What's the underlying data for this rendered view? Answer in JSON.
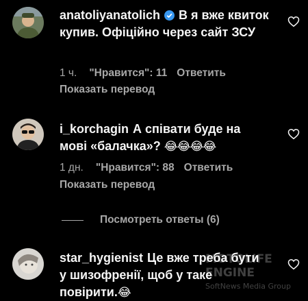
{
  "comments": [
    {
      "username": "anatoliyanatolich",
      "verified": true,
      "text": "В я вже квиток купив. Офіційно через сайт ЗСУ",
      "time": "1 ч.",
      "likes": "\"Нравится\": 11",
      "reply": "Ответить",
      "translate": "Показать перевод",
      "avatar_icon": "avatar-man-icon"
    },
    {
      "username": "i_korchagin",
      "verified": false,
      "text_line1": "А співати буде на",
      "text_line2": "мові «балачка»?",
      "emoji": "😂😂😂😂",
      "time": "1 дн.",
      "likes": "\"Нравится\": 88",
      "reply": "Ответить",
      "translate": "Показать перевод",
      "replies_label": "Посмотреть ответы (6)",
      "avatar_icon": "avatar-sunglasses-icon"
    },
    {
      "username": "star_hygienist",
      "verified": false,
      "text_line1": "Це вже треба бути",
      "text_line2": "у шизофренії, щоб у таке",
      "text_line3": "повірити.",
      "emoji": "😂",
      "avatar_icon": "avatar-face-icon"
    }
  ],
  "watermark": {
    "line1": "MOTOLIFE ENGINE",
    "line2": "SoftNews Media Group"
  },
  "colors": {
    "background": "#000000",
    "text": "#f5f5f5",
    "muted": "#a8a8a8",
    "verified": "#3897f0"
  }
}
